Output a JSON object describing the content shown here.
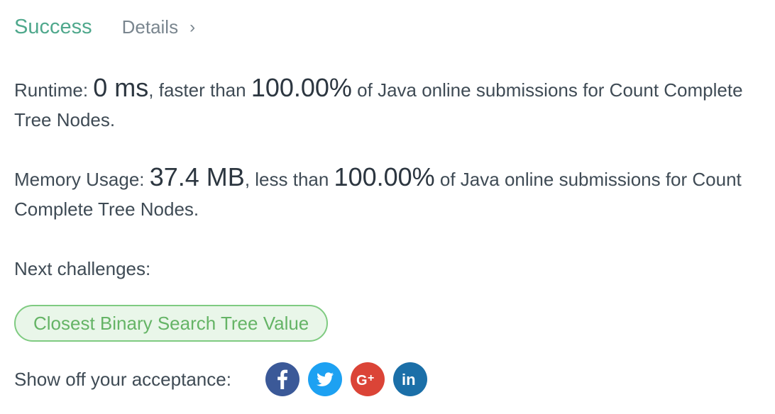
{
  "header": {
    "status": "Success",
    "details_label": "Details",
    "chevron": "›"
  },
  "runtime": {
    "label": "Runtime: ",
    "value": "0 ms",
    "comparison": ", faster than ",
    "percent": "100.00%",
    "suffix": " of Java online submissions for Count Complete Tree Nodes."
  },
  "memory": {
    "label": "Memory Usage: ",
    "value": "37.4 MB",
    "comparison": ", less than ",
    "percent": "100.00%",
    "suffix": " of Java online submissions for Count Complete Tree Nodes."
  },
  "next": {
    "label": "Next challenges:",
    "challenges": [
      "Closest Binary Search Tree Value"
    ]
  },
  "share": {
    "label": "Show off your acceptance:",
    "icons": [
      "facebook-icon",
      "twitter-icon",
      "google-plus-icon",
      "linkedin-icon"
    ]
  },
  "colors": {
    "success": "#4fa88c",
    "pill_border": "#7fcb81",
    "pill_bg": "#e9f6e9",
    "facebook": "#3b5998",
    "twitter": "#1da1f2",
    "google_plus": "#db4437",
    "linkedin": "#1b6fa8"
  }
}
